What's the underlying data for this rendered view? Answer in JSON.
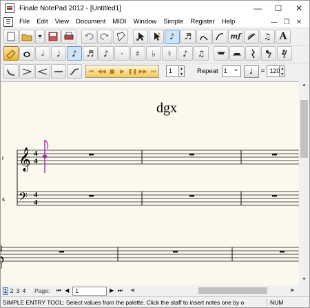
{
  "app": {
    "title": "Finale NotePad 2012 - [Untitled1]",
    "minimize_glyph": "—",
    "maximize_glyph": "☐",
    "close_glyph": "✕"
  },
  "menu": {
    "items": [
      "File",
      "Edit",
      "View",
      "Document",
      "MIDI",
      "Window",
      "Simple",
      "Register",
      "Help"
    ],
    "mdi_minimize": "—",
    "mdi_restore": "❐",
    "mdi_close": "✕"
  },
  "toolbar1": {
    "icons": [
      "new-icon",
      "open-icon",
      "save-icon",
      "print-icon",
      "undo-icon",
      "redo-icon",
      "selection-tool-icon",
      "selection-tool-icon",
      "play-tool-icon",
      "eighth-note-tool-icon",
      "beamed-notes-tool-icon",
      "slur-tool-icon",
      "hairpin-tool-icon",
      "mezzo-forte-icon",
      "tempo-icon",
      "lyrics-icon",
      "text-tool-icon"
    ],
    "text_tool_label": "A"
  },
  "toolbar2": {
    "icons": [
      "eraser-icon",
      "whole-note-icon",
      "half-note-icon",
      "quarter-note-icon",
      "eighth-note-icon",
      "sixteenth-note-icon",
      "thirty-second-note-icon",
      "dot-icon",
      "sharp-icon",
      "flat-icon",
      "natural-icon",
      "tie-icon",
      "tuplet-icon",
      "whole-rest-icon",
      "half-rest-icon",
      "quarter-rest-icon",
      "eighth-rest-icon",
      "sixteenth-rest-icon"
    ]
  },
  "toolbar3": {
    "icons": [
      "slur-icon",
      "crescendo-icon",
      "decrescendo-icon",
      "line-icon",
      "gliss-icon"
    ],
    "playback": [
      "⏮",
      "◀◀",
      "■",
      "▶",
      "❚❚",
      "▶▶",
      "⏭"
    ],
    "measure_value": "1",
    "repeat_label": "Repeat",
    "repeat_value": "1",
    "tempo_equals": "=",
    "tempo_value": "120"
  },
  "score": {
    "title": "dgx",
    "staff1_label": "r",
    "staff2_label": "s",
    "time_signature_top": "4",
    "time_signature_bottom": "4"
  },
  "nav": {
    "pages": [
      "1",
      "2",
      "3",
      "4"
    ],
    "page_label": "Page:",
    "page_value": "1"
  },
  "status": {
    "text": "SIMPLE ENTRY TOOL: Select values from the palette. Click the staff to insert notes one by o",
    "num": "NUM"
  },
  "colors": {
    "paper": "#fbf9ee",
    "cursor": "#b21fb2",
    "active_button": "#cfe4f8"
  }
}
